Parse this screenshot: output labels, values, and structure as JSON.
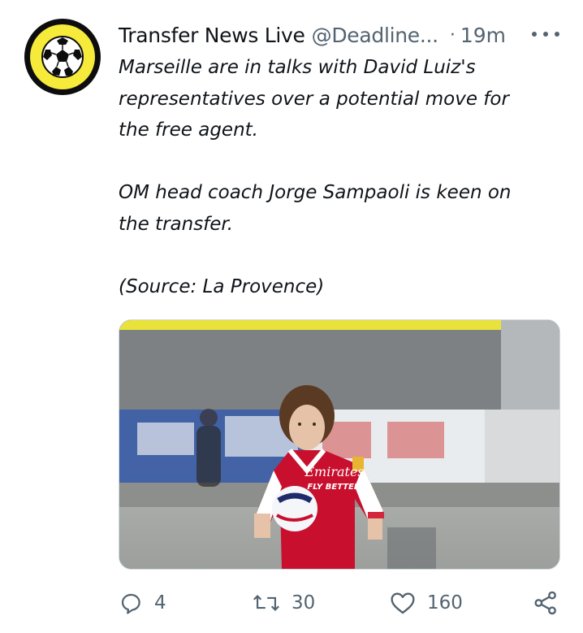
{
  "tweet": {
    "author_name": "Transfer News Live",
    "author_handle": "@Deadline...",
    "separator": "·",
    "time": "19m",
    "avatar_icon": "football-icon",
    "paragraphs": [
      [
        "Marseille are in talks with David Luiz's",
        "representatives over a potential move for",
        "the free agent."
      ],
      [
        "OM head coach Jorge Sampaoli is keen on",
        "the transfer."
      ],
      [
        "(Source: La Provence)"
      ]
    ],
    "media": {
      "kit_sponsor_line1": "Emirates",
      "kit_sponsor_line2": "FLY BETTER",
      "description_icon": "photo-football-player"
    }
  },
  "actions": {
    "reply": {
      "icon": "reply-icon",
      "count": "4"
    },
    "retweet": {
      "icon": "retweet-icon",
      "count": "30"
    },
    "like": {
      "icon": "heart-icon",
      "count": "160"
    },
    "share": {
      "icon": "share-icon"
    }
  },
  "colors": {
    "avatar_yellow": "#f6ea3a",
    "secondary_text": "#536471",
    "arsenal_red": "#c8102e"
  }
}
